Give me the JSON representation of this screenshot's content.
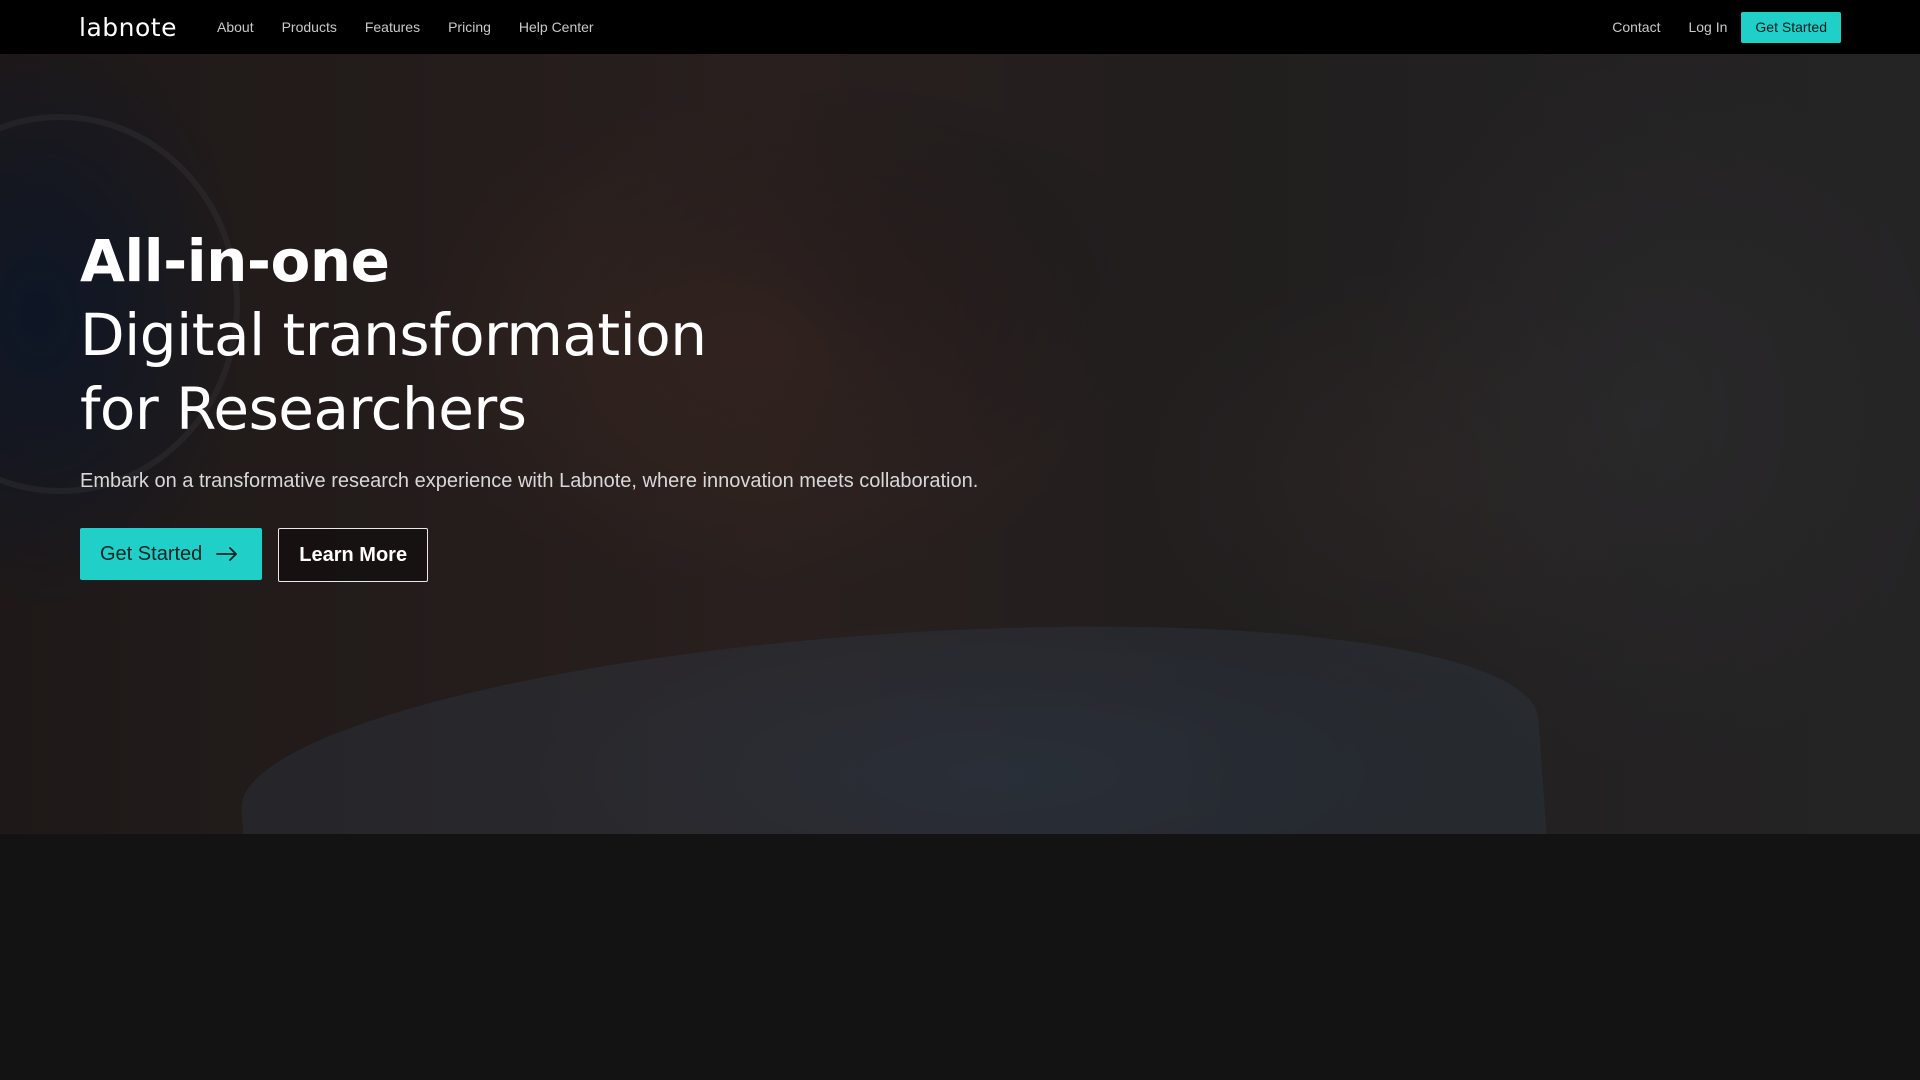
{
  "nav": {
    "logo": "labnote",
    "left_links": [
      "About",
      "Products",
      "Features",
      "Pricing",
      "Help Center"
    ],
    "contact": "Contact",
    "login": "Log In",
    "cta": "Get Started",
    "accent": "#1fcfc8"
  },
  "hero": {
    "headline_bold": "All-in-one",
    "headline_line2": "Digital transformation",
    "headline_line3": "for Researchers",
    "subtitle": "Embark on a transformative research experience with Labnote, where innovation meets collaboration.",
    "primary_cta": "Get Started",
    "primary_icon": "arrow-right-icon",
    "secondary_cta": "Learn More"
  }
}
